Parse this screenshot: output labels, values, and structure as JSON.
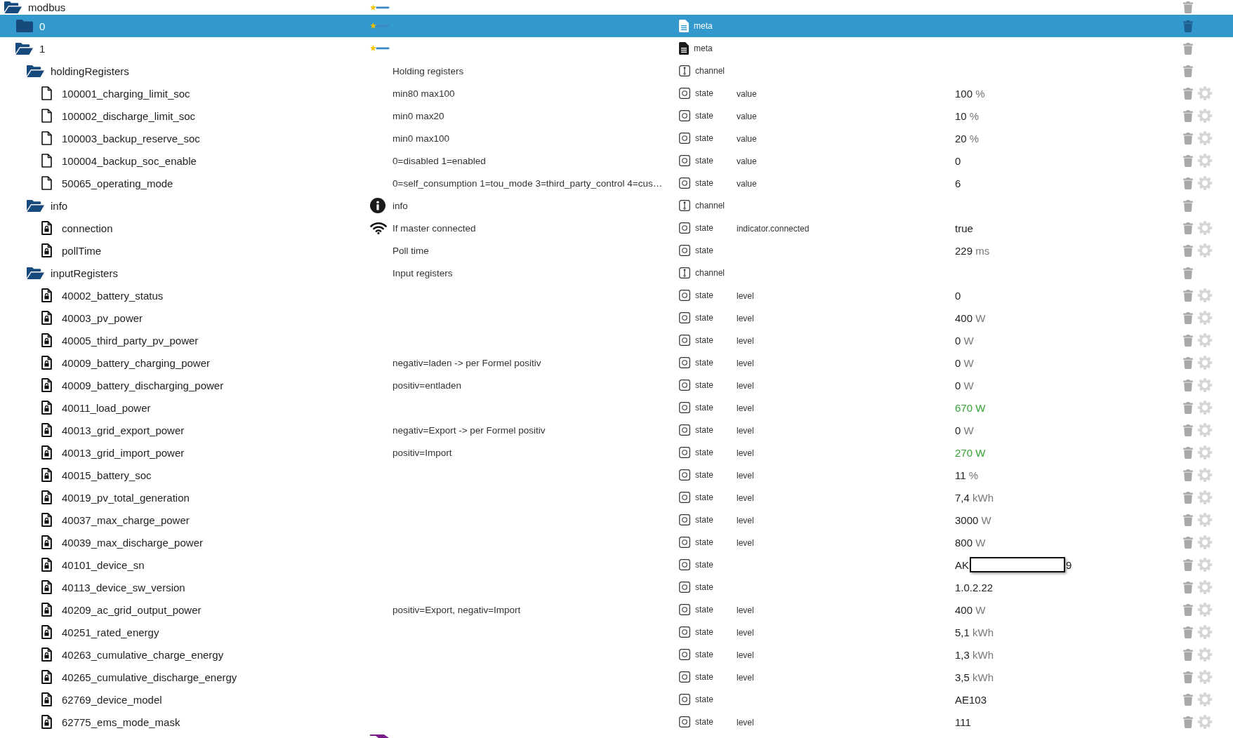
{
  "tree": [
    {
      "name": "modbus",
      "kind": "folder",
      "expanded": true,
      "selected": false,
      "badge": {
        "kind": "logo"
      },
      "children": [
        {
          "name": "0",
          "kind": "folder",
          "expanded": false,
          "selected": true,
          "badge": {
            "kind": "logo"
          },
          "type": {
            "label": "meta",
            "kind": "meta"
          }
        },
        {
          "name": "1",
          "kind": "folder",
          "expanded": true,
          "selected": false,
          "badge": {
            "kind": "logo"
          },
          "type": {
            "label": "meta",
            "kind": "meta"
          },
          "children": [
            {
              "name": "holdingRegisters",
              "kind": "folder",
              "expanded": true,
              "selected": false,
              "description": "Holding registers",
              "type": {
                "label": "channel",
                "kind": "channel"
              },
              "children": [
                {
                  "name": "100001_charging_limit_soc",
                  "kind": "file",
                  "selected": false,
                  "description": "min80 max100",
                  "type": {
                    "label": "state",
                    "kind": "state"
                  },
                  "role": "value",
                  "value": "100",
                  "unit": "%",
                  "highlighted": false
                },
                {
                  "name": "100002_discharge_limit_soc",
                  "kind": "file",
                  "selected": false,
                  "description": "min0 max20",
                  "type": {
                    "label": "state",
                    "kind": "state"
                  },
                  "role": "value",
                  "value": "10",
                  "unit": "%",
                  "highlighted": false
                },
                {
                  "name": "100003_backup_reserve_soc",
                  "kind": "file",
                  "selected": false,
                  "description": "min0 max100",
                  "type": {
                    "label": "state",
                    "kind": "state"
                  },
                  "role": "value",
                  "value": "20",
                  "unit": "%",
                  "highlighted": false
                },
                {
                  "name": "100004_backup_soc_enable",
                  "kind": "file",
                  "selected": false,
                  "description": "0=disabled 1=enabled",
                  "type": {
                    "label": "state",
                    "kind": "state"
                  },
                  "role": "value",
                  "value": "0",
                  "highlighted": false
                },
                {
                  "name": "50065_operating_mode",
                  "kind": "file",
                  "selected": false,
                  "description": "0=self_consumption 1=tou_mode 3=third_party_control 4=cus…",
                  "type": {
                    "label": "state",
                    "kind": "state"
                  },
                  "role": "value",
                  "value": "6",
                  "highlighted": false
                }
              ]
            },
            {
              "name": "info",
              "kind": "folder",
              "expanded": true,
              "selected": false,
              "badge": {
                "kind": "info"
              },
              "description": "info",
              "type": {
                "label": "channel",
                "kind": "channel"
              },
              "children": [
                {
                  "name": "connection",
                  "kind": "locked_file",
                  "selected": false,
                  "badge": {
                    "kind": "wifi"
                  },
                  "description": "If master connected",
                  "type": {
                    "label": "state",
                    "kind": "state"
                  },
                  "role": "indicator.connected",
                  "value": "true",
                  "highlighted": false
                },
                {
                  "name": "pollTime",
                  "kind": "locked_file",
                  "selected": false,
                  "description": "Poll time",
                  "type": {
                    "label": "state",
                    "kind": "state"
                  },
                  "value": "229",
                  "unit": "ms",
                  "highlighted": false
                }
              ]
            },
            {
              "name": "inputRegisters",
              "kind": "folder",
              "expanded": true,
              "selected": false,
              "description": "Input registers",
              "type": {
                "label": "channel",
                "kind": "channel"
              },
              "children": [
                {
                  "name": "40002_battery_status",
                  "kind": "locked_file",
                  "selected": false,
                  "type": {
                    "label": "state",
                    "kind": "state"
                  },
                  "role": "level",
                  "value": "0",
                  "highlighted": false
                },
                {
                  "name": "40003_pv_power",
                  "kind": "locked_file",
                  "selected": false,
                  "type": {
                    "label": "state",
                    "kind": "state"
                  },
                  "role": "level",
                  "value": "400",
                  "unit": "W",
                  "highlighted": false
                },
                {
                  "name": "40005_third_party_pv_power",
                  "kind": "locked_file",
                  "selected": false,
                  "type": {
                    "label": "state",
                    "kind": "state"
                  },
                  "role": "level",
                  "value": "0",
                  "unit": "W",
                  "highlighted": false
                },
                {
                  "name": "40009_battery_charging_power",
                  "kind": "locked_file",
                  "selected": false,
                  "description": "negativ=laden -> per Formel positiv",
                  "type": {
                    "label": "state",
                    "kind": "state"
                  },
                  "role": "level",
                  "value": "0",
                  "unit": "W",
                  "highlighted": false
                },
                {
                  "name": "40009_battery_discharging_power",
                  "kind": "locked_file",
                  "selected": false,
                  "description": "positiv=entladen",
                  "type": {
                    "label": "state",
                    "kind": "state"
                  },
                  "role": "level",
                  "value": "0",
                  "unit": "W",
                  "highlighted": false
                },
                {
                  "name": "40011_load_power",
                  "kind": "locked_file",
                  "selected": false,
                  "type": {
                    "label": "state",
                    "kind": "state"
                  },
                  "role": "level",
                  "value": "670",
                  "unit": "W",
                  "highlighted": true
                },
                {
                  "name": "40013_grid_export_power",
                  "kind": "locked_file",
                  "selected": false,
                  "description": "negativ=Export -> per Formel positiv",
                  "type": {
                    "label": "state",
                    "kind": "state"
                  },
                  "role": "level",
                  "value": "0",
                  "unit": "W",
                  "highlighted": false
                },
                {
                  "name": "40013_grid_import_power",
                  "kind": "locked_file",
                  "selected": false,
                  "description": "positiv=Import",
                  "type": {
                    "label": "state",
                    "kind": "state"
                  },
                  "role": "level",
                  "value": "270",
                  "unit": "W",
                  "highlighted": true
                },
                {
                  "name": "40015_battery_soc",
                  "kind": "locked_file",
                  "selected": false,
                  "type": {
                    "label": "state",
                    "kind": "state"
                  },
                  "role": "level",
                  "value": "11",
                  "unit": "%",
                  "highlighted": false
                },
                {
                  "name": "40019_pv_total_generation",
                  "kind": "locked_file",
                  "selected": false,
                  "type": {
                    "label": "state",
                    "kind": "state"
                  },
                  "role": "level",
                  "value": "7,4",
                  "unit": "kWh",
                  "highlighted": false
                },
                {
                  "name": "40037_max_charge_power",
                  "kind": "locked_file",
                  "selected": false,
                  "type": {
                    "label": "state",
                    "kind": "state"
                  },
                  "role": "level",
                  "value": "3000",
                  "unit": "W",
                  "highlighted": false
                },
                {
                  "name": "40039_max_discharge_power",
                  "kind": "locked_file",
                  "selected": false,
                  "type": {
                    "label": "state",
                    "kind": "state"
                  },
                  "role": "level",
                  "value": "800",
                  "unit": "W",
                  "highlighted": false
                },
                {
                  "name": "40101_device_sn",
                  "kind": "locked_file",
                  "selected": false,
                  "type": {
                    "label": "state",
                    "kind": "state"
                  },
                  "value": "AK",
                  "redacted": true,
                  "value_end": "9",
                  "highlighted": false
                },
                {
                  "name": "40113_device_sw_version",
                  "kind": "locked_file",
                  "selected": false,
                  "type": {
                    "label": "state",
                    "kind": "state"
                  },
                  "value": "1.0.2.22",
                  "highlighted": false
                },
                {
                  "name": "40209_ac_grid_output_power",
                  "kind": "locked_file",
                  "selected": false,
                  "description": "positiv=Export, negativ=Import",
                  "type": {
                    "label": "state",
                    "kind": "state"
                  },
                  "role": "level",
                  "value": "400",
                  "unit": "W",
                  "highlighted": false
                },
                {
                  "name": "40251_rated_energy",
                  "kind": "locked_file",
                  "selected": false,
                  "type": {
                    "label": "state",
                    "kind": "state"
                  },
                  "role": "level",
                  "value": "5,1",
                  "unit": "kWh",
                  "highlighted": false
                },
                {
                  "name": "40263_cumulative_charge_energy",
                  "kind": "locked_file",
                  "selected": false,
                  "type": {
                    "label": "state",
                    "kind": "state"
                  },
                  "role": "level",
                  "value": "1,3",
                  "unit": "kWh",
                  "highlighted": false
                },
                {
                  "name": "40265_cumulative_discharge_energy",
                  "kind": "locked_file",
                  "selected": false,
                  "type": {
                    "label": "state",
                    "kind": "state"
                  },
                  "role": "level",
                  "value": "3,5",
                  "unit": "kWh",
                  "highlighted": false
                },
                {
                  "name": "62769_device_model",
                  "kind": "locked_file",
                  "selected": false,
                  "type": {
                    "label": "state",
                    "kind": "state"
                  },
                  "value": "AE103",
                  "highlighted": false
                },
                {
                  "name": "62775_ems_mode_mask",
                  "kind": "locked_file",
                  "selected": false,
                  "type": {
                    "label": "state",
                    "kind": "state"
                  },
                  "role": "level",
                  "value": "111",
                  "highlighted": false
                }
              ]
            }
          ]
        }
      ]
    }
  ]
}
